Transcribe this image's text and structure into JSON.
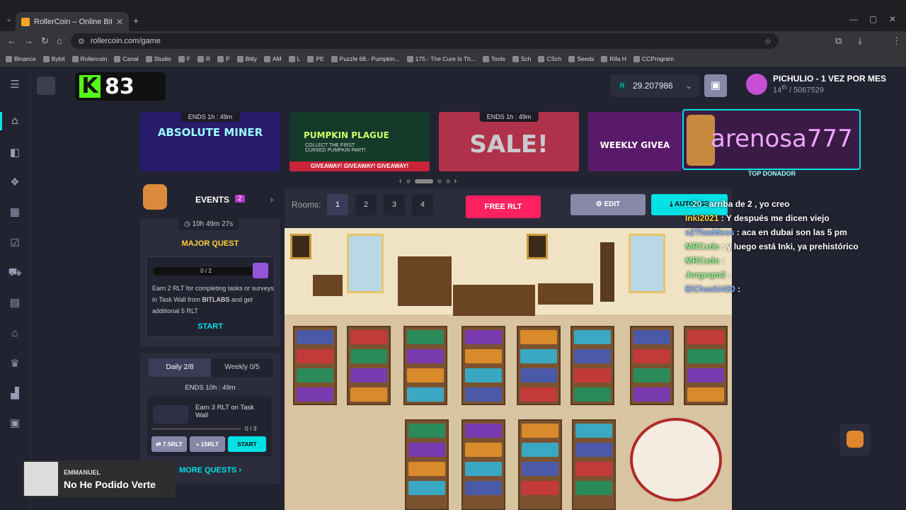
{
  "browser": {
    "tab_title": "RollerCoin – Online Bitcoin Mi",
    "tab_close": "✕",
    "new_tab": "+",
    "url": "rollercoin.com/game",
    "bookmarks": [
      "Binance",
      "Bybit",
      "Rollercoin",
      "Canal",
      "Studio",
      "F",
      "R",
      "P",
      "Bitly",
      "AM",
      "L",
      "PE",
      "Puzzle 68.- Pumpkin...",
      "175.- The Cure Is Th...",
      "Tools",
      "Sch",
      "CSch",
      "Seeds",
      "Rifa H",
      "CCProgram"
    ]
  },
  "kick": {
    "count": "83"
  },
  "wallet": {
    "balance": "29.207986"
  },
  "user": {
    "name": "PICHULIO - 1 VEZ POR MES",
    "rank": "14",
    "rank_suffix": "th",
    "total": "/ 5067529"
  },
  "banners": [
    {
      "ends": "ENDS  1h : 49m",
      "title": "ABSOLUTE MINER",
      "color": "#2a1a6a"
    },
    {
      "ends": "",
      "title": "PUMPKIN PLAGUE",
      "sub": "COLLECT THE FIRST CURSED PUMPKIN PART!",
      "footer": "GIVEAWAY!   GIVEAWAY!   GIVEAWAY!",
      "color": "#143a2a"
    },
    {
      "ends": "ENDS  1h : 49m",
      "title": "SALE!",
      "color": "#b0324a"
    },
    {
      "ends": "",
      "title": "WEEKLY GIVEA",
      "color": "#5a1a6a"
    }
  ],
  "donor": {
    "name": "arenosa777",
    "label": "TOP DONADOR"
  },
  "events": {
    "label": "EVENTS",
    "count": "2"
  },
  "major_quest": {
    "timer": "10h 49m 27s",
    "title": "MAJOR QUEST",
    "progress": "0 / 2",
    "description_1": "Earn 2 RLT for completing tasks or surveys in Task Wall from ",
    "description_bold": "BITLABS",
    "description_2": " and get additional 5 RLT",
    "start": "START"
  },
  "daily": {
    "tab_daily": "Daily  2/8",
    "tab_weekly": "Weekly  0/5",
    "ends": "ENDS  10h : 49m",
    "quest_text": "Earn 3 RLT on Task Wall",
    "progress": "0 / 3",
    "btn1": "⇄ 7.5RLT",
    "btn2": "» 15RLT",
    "start": "START",
    "more": "MORE QUESTS  ›"
  },
  "game": {
    "rooms_label": "Rooms:",
    "rooms": [
      "1",
      "2",
      "3",
      "4"
    ],
    "free": "FREE RLT",
    "edit": "EDIT",
    "autouse": "AUTOUSE"
  },
  "chat": [
    {
      "user": "...20",
      "text": ": arriba de 2 , yo creo"
    },
    {
      "user": "Inki2021",
      "text": ": Y después me dicen viejo"
    },
    {
      "user": "s2Thaddess",
      "text": ": aca en dubai son las 5 pm"
    },
    {
      "user": "MRCxde",
      "text": ": y luego está Inki, ya prehistórico"
    },
    {
      "user": "MRCxde",
      "text": ":"
    },
    {
      "user": "Jorgeqm2",
      "text": ":"
    },
    {
      "user": "ElChaski420",
      "text": ":"
    }
  ],
  "now_playing": {
    "artist": "EMMANUEL",
    "song": "No He Podido Verte"
  }
}
